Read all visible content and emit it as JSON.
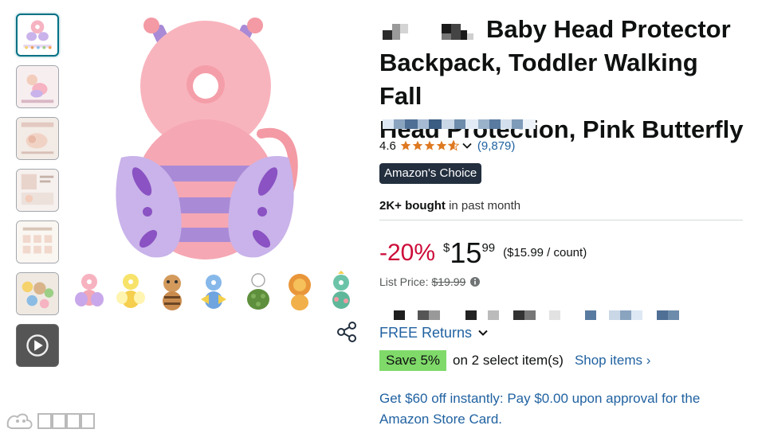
{
  "product": {
    "title_line1": "Baby Head Protector",
    "title_line2": "Backpack, Toddler Walking Fall",
    "title_line3": "Head Protection, Pink Butterfly"
  },
  "rating": {
    "value": "4.6",
    "stars_fraction": 0.92,
    "count": "(9,879)"
  },
  "badge": {
    "label": "Amazon's Choice"
  },
  "bought": {
    "bold": "2K+ bought",
    "rest": " in past month"
  },
  "price": {
    "discount": "-20%",
    "currency": "$",
    "whole": "15",
    "fraction": "99",
    "per_unit": "($15.99 / count)",
    "list_label": "List Price:",
    "list_value": "$19.99"
  },
  "returns": {
    "label": "FREE Returns"
  },
  "coupon": {
    "badge": "Save 5%",
    "text": "on 2 select item(s)",
    "link": "Shop items ›"
  },
  "promo": {
    "text": "Get $60 off instantly: Pay $0.00 upon approval for the Amazon Store Card."
  },
  "colors": {
    "link": "#2162a1",
    "discount": "#cc0c39",
    "badge_bg": "#232f3e",
    "save_bg": "#7fda69",
    "star": "#de7921"
  },
  "thumbnails": [
    {
      "icon": "butterfly-thumbnail",
      "selected": true
    },
    {
      "icon": "baby-photo-thumbnail"
    },
    {
      "icon": "baby-photo-thumbnail"
    },
    {
      "icon": "infographic-thumbnail"
    },
    {
      "icon": "size-chart-thumbnail"
    },
    {
      "icon": "collection-thumbnail"
    },
    {
      "icon": "video-play-icon"
    }
  ],
  "variants": [
    "butterfly",
    "bee",
    "tiger",
    "bird",
    "turtle",
    "lion",
    "dinosaur"
  ]
}
